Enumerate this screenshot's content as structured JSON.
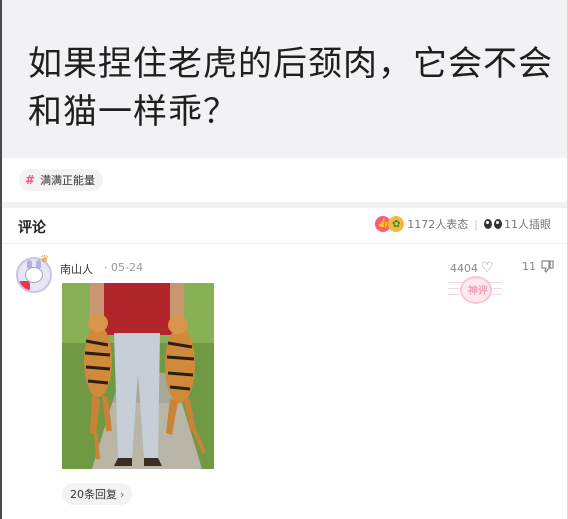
{
  "post": {
    "title": "如果捏住老虎的后颈肉，它会不会和猫一样乖？",
    "topic": "满满正能量"
  },
  "comments_header": {
    "title": "评论",
    "reactions_count": "1172人表态",
    "insert_eyes_count": "11人插眼"
  },
  "comment": {
    "author": "南山人",
    "date": "· 05-24",
    "likes": "4404",
    "dislikes": "11",
    "stamp_text": "神评",
    "replies": "20条回复",
    "icons": {
      "like": "heart-outline-icon",
      "dislike": "thumbs-down-outline-icon",
      "reply_chevron": "chevron-right-icon"
    }
  },
  "colors": {
    "accent": "#ff4f7b",
    "title_bg": "#f2f2f4",
    "text_primary": "#1f1f1f",
    "text_secondary": "#888888"
  }
}
